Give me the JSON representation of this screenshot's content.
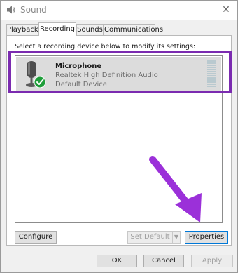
{
  "window": {
    "title": "Sound",
    "close_glyph": "✕"
  },
  "tabs": [
    {
      "label": "Playback",
      "active": false
    },
    {
      "label": "Recording",
      "active": true
    },
    {
      "label": "Sounds",
      "active": false
    },
    {
      "label": "Communications",
      "active": false
    }
  ],
  "panel": {
    "instruction": "Select a recording device below to modify its settings:"
  },
  "devices": [
    {
      "name": "Microphone",
      "driver": "Realtek High Definition Audio",
      "status": "Default Device",
      "icon": "microphone-icon",
      "badge": "default-checkmark-icon"
    }
  ],
  "panel_buttons": {
    "configure": "Configure",
    "set_default": "Set Default",
    "set_default_arrow": "▼",
    "properties": "Properties"
  },
  "dialog_buttons": {
    "ok": "OK",
    "cancel": "Cancel",
    "apply": "Apply"
  },
  "colors": {
    "highlight": "#7b2bb0",
    "arrow": "#9b30d9",
    "check": "#1f9e3a",
    "selection": "#dcdcdc"
  }
}
